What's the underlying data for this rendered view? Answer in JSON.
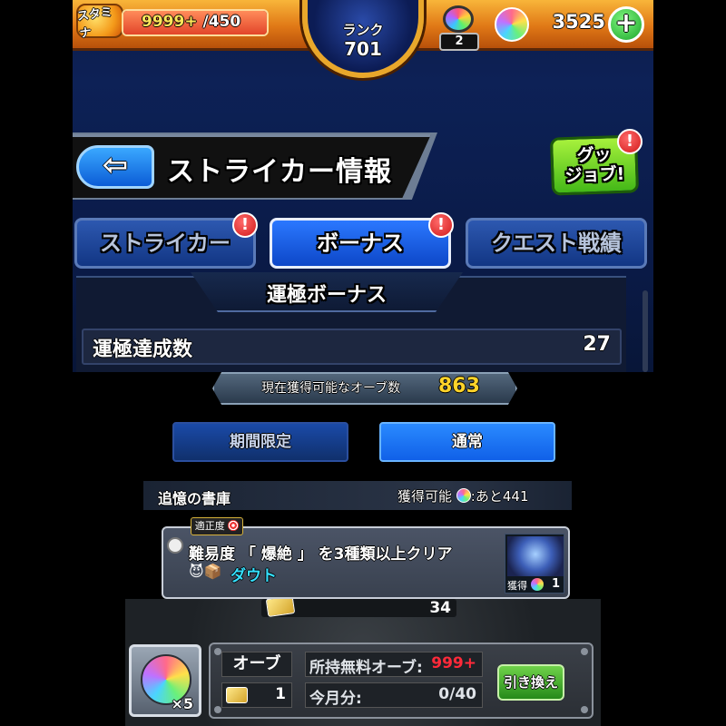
{
  "top_bar": {
    "stamina_label": "スタミナ",
    "stamina_value": "9999+",
    "stamina_max": "/450",
    "stamina_fill_fraction": 1.0,
    "rank_label": "ランク",
    "rank_value": "701",
    "orb_gauge_count": "2",
    "orb_count": "3525",
    "add_button_symbol": "+"
  },
  "header": {
    "back_symbol": "⇦",
    "title": "ストライカー情報",
    "good_job_line1": "グッ",
    "good_job_line2": "ジョブ!",
    "alert_symbol": "!"
  },
  "tabs": [
    {
      "label": "ストライカー",
      "active": false,
      "alert": true
    },
    {
      "label": "ボーナス",
      "active": true,
      "alert": true
    },
    {
      "label": "クエスト戦績",
      "active": false,
      "alert": false
    }
  ],
  "bonus": {
    "title": "運極ボーナス",
    "row_label": "運極達成数",
    "row_value": "27"
  },
  "orb_available": {
    "label": "現在獲得可能なオーブ数",
    "value": "863"
  },
  "subtabs": [
    {
      "label": "期間限定",
      "active": false
    },
    {
      "label": "通常",
      "active": true
    }
  ],
  "library": {
    "title": "追憶の書庫",
    "remaining_prefix": "獲得可能",
    "remaining_suffix": ":あと441"
  },
  "quest": {
    "tag": "適正度",
    "text": "難易度 「 爆絶 」 を3種類以上クリア",
    "icons": "😈📦",
    "monster_name": "ダウト",
    "reward_label": "獲得",
    "reward_count": "1"
  },
  "ticket_row": {
    "count": "34"
  },
  "exchange": {
    "orb_qty": "×5",
    "orb_label": "オーブ",
    "ticket_count": "1",
    "free_orb_label": "所持無料オーブ:",
    "free_orb_value": "999+",
    "monthly_label": "今月分:",
    "monthly_value": "0/40",
    "button_label": "引き換え"
  },
  "colors": {
    "accent_orange": "#e07816",
    "active_tab_blue": "#0d47c8",
    "orb_count_yellow": "#ffd42a",
    "alert_red": "#d11a1a",
    "exchange_green": "#268a1a"
  }
}
